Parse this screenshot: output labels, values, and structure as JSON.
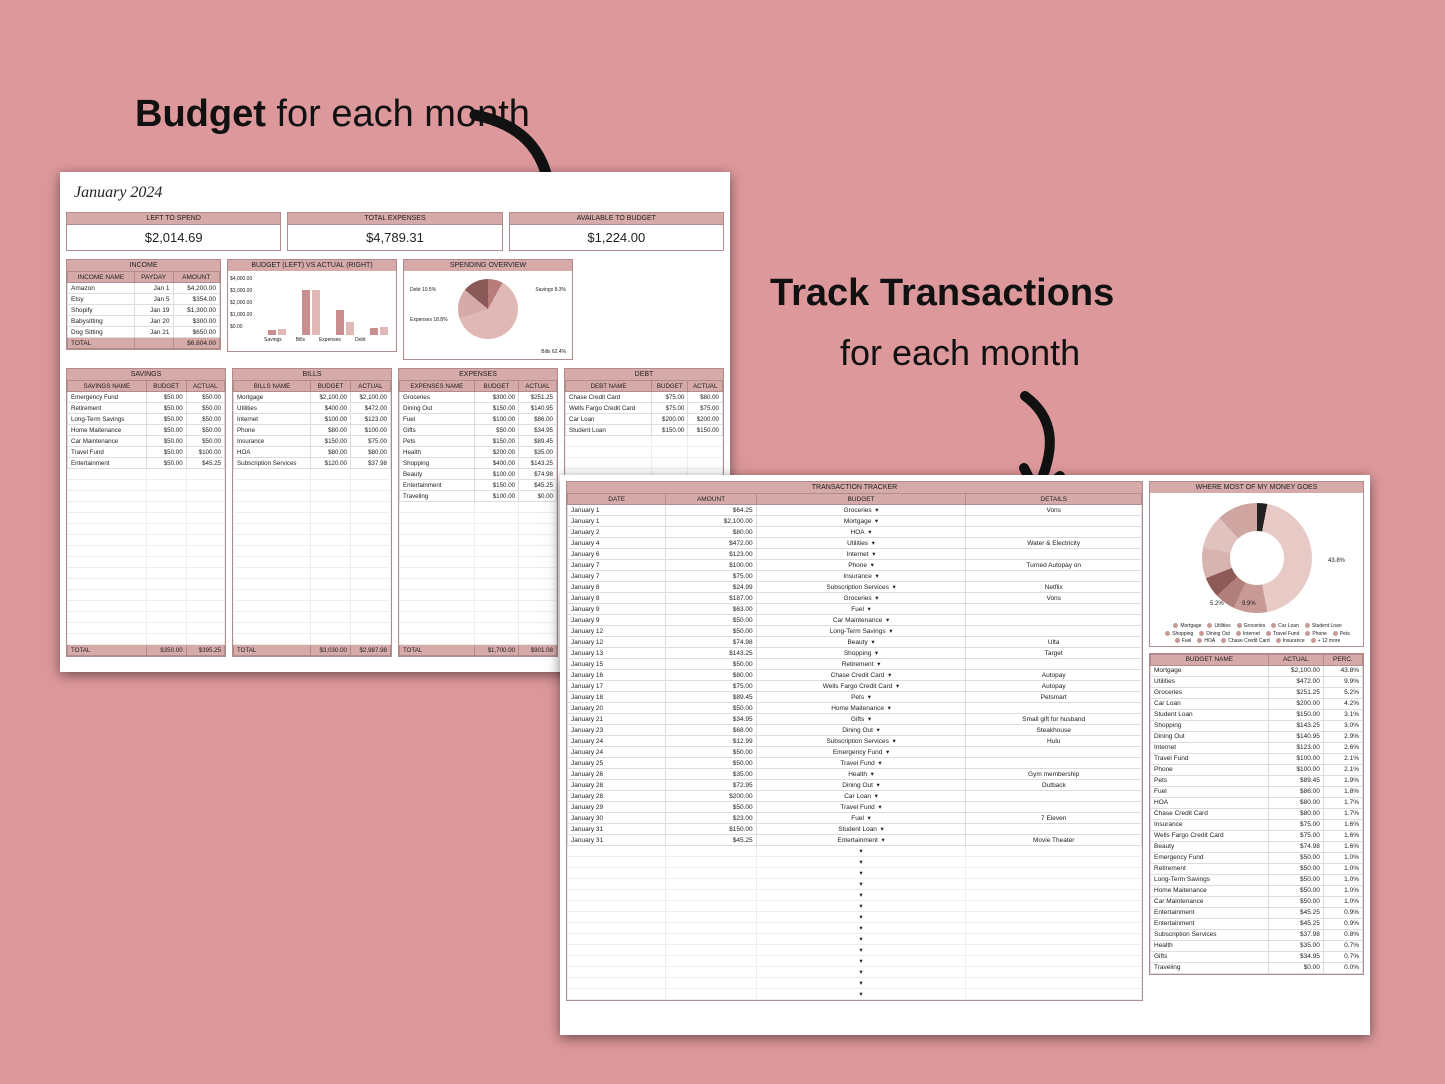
{
  "headings": {
    "h1_b": "Budget",
    "h1_r": " for each month",
    "h2_b": "Track Transactions",
    "h2_sub": "for each month"
  },
  "sheet1": {
    "title": "January 2024",
    "kpis": [
      {
        "label": "LEFT TO SPEND",
        "value": "$2,014.69"
      },
      {
        "label": "TOTAL EXPENSES",
        "value": "$4,789.31"
      },
      {
        "label": "AVAILABLE TO BUDGET",
        "value": "$1,224.00"
      }
    ],
    "income": {
      "title": "INCOME",
      "headers": [
        "INCOME NAME",
        "PAYDAY",
        "AMOUNT"
      ],
      "rows": [
        [
          "Amazon",
          "Jan 1",
          "$4,200.00"
        ],
        [
          "Etsy",
          "Jan 5",
          "$354.00"
        ],
        [
          "Shopify",
          "Jan 19",
          "$1,300.00"
        ],
        [
          "Babysitting",
          "Jan 20",
          "$300.00"
        ],
        [
          "Dog Sitting",
          "Jan 21",
          "$650.00"
        ]
      ],
      "total": [
        "TOTAL",
        "",
        "$6,804.00"
      ]
    },
    "chart": {
      "title": "BUDGET (LEFT) VS ACTUAL (RIGHT)",
      "ylabels": [
        "$4,000.00",
        "$3,000.00",
        "$2,000.00",
        "$1,000.00",
        "$0.00"
      ],
      "categories": [
        "Savings",
        "Bills",
        "Expenses",
        "Debt"
      ],
      "series": [
        {
          "name": "Budget",
          "values": [
            350,
            3030,
            1700,
            500
          ]
        },
        {
          "name": "Actual",
          "values": [
            395,
            2988,
            901,
            505
          ]
        }
      ]
    },
    "overview": {
      "title": "SPENDING OVERVIEW",
      "labels": {
        "debt": "Debt\n10.5%",
        "expenses": "Expenses\n18.8%",
        "savings": "Savings\n8.3%",
        "bills": "Bills\n62.4%"
      }
    },
    "savings": {
      "title": "SAVINGS",
      "headers": [
        "SAVINGS NAME",
        "BUDGET",
        "ACTUAL"
      ],
      "rows": [
        [
          "Emergency Fund",
          "$50.00",
          "$50.00"
        ],
        [
          "Retirement",
          "$50.00",
          "$50.00"
        ],
        [
          "Long-Term Savings",
          "$50.00",
          "$50.00"
        ],
        [
          "Home Maitenance",
          "$50.00",
          "$50.00"
        ],
        [
          "Car Maintenance",
          "$50.00",
          "$50.00"
        ],
        [
          "Travel Fund",
          "$50.00",
          "$100.00"
        ],
        [
          "Entertainment",
          "$50.00",
          "$45.25"
        ]
      ],
      "total": [
        "TOTAL",
        "$350.00",
        "$395.25"
      ]
    },
    "bills": {
      "title": "BILLS",
      "headers": [
        "BILLS NAME",
        "BUDGET",
        "ACTUAL"
      ],
      "rows": [
        [
          "Mortgage",
          "$2,100.00",
          "$2,100.00"
        ],
        [
          "Utilities",
          "$400.00",
          "$472.00"
        ],
        [
          "Internet",
          "$100.00",
          "$123.00"
        ],
        [
          "Phone",
          "$80.00",
          "$100.00"
        ],
        [
          "Insurance",
          "$150.00",
          "$75.00"
        ],
        [
          "HOA",
          "$80.00",
          "$80.00"
        ],
        [
          "Subscription Services",
          "$120.00",
          "$37.98"
        ]
      ],
      "total": [
        "TOTAL",
        "$3,030.00",
        "$2,987.98"
      ]
    },
    "expenses": {
      "title": "EXPENSES",
      "headers": [
        "EXPENSES NAME",
        "BUDGET",
        "ACTUAL"
      ],
      "rows": [
        [
          "Groceries",
          "$300.00",
          "$251.25"
        ],
        [
          "Dining Out",
          "$150.00",
          "$140.95"
        ],
        [
          "Fuel",
          "$100.00",
          "$86.00"
        ],
        [
          "Gifts",
          "$50.00",
          "$34.95"
        ],
        [
          "Pets",
          "$150.00",
          "$89.45"
        ],
        [
          "Health",
          "$200.00",
          "$35.00"
        ],
        [
          "Shopping",
          "$400.00",
          "$143.25"
        ],
        [
          "Beauty",
          "$100.00",
          "$74.98"
        ],
        [
          "Entertainment",
          "$150.00",
          "$45.25"
        ],
        [
          "Traveling",
          "$100.00",
          "$0.00"
        ]
      ],
      "total": [
        "TOTAL",
        "$1,700.00",
        "$901.08"
      ]
    },
    "debt": {
      "title": "DEBT",
      "headers": [
        "DEBT NAME",
        "BUDGET",
        "ACTUAL"
      ],
      "rows": [
        [
          "Chase Credit Card",
          "$75.00",
          "$80.00"
        ],
        [
          "Wells Fargo Credit Card",
          "$75.00",
          "$75.00"
        ],
        [
          "Car Loan",
          "$200.00",
          "$200.00"
        ],
        [
          "Student Loan",
          "$150.00",
          "$150.00"
        ]
      ]
    }
  },
  "sheet2": {
    "tracker": {
      "title": "TRANSACTION TRACKER",
      "headers": [
        "DATE",
        "AMOUNT",
        "BUDGET",
        "DETAILS"
      ],
      "rows": [
        [
          "January 1",
          "$64.25",
          "Groceries",
          "Vons"
        ],
        [
          "January 1",
          "$2,100.00",
          "Mortgage",
          ""
        ],
        [
          "January 2",
          "$80.00",
          "HOA",
          ""
        ],
        [
          "January 4",
          "$472.00",
          "Utilities",
          "Water & Electricity"
        ],
        [
          "January 6",
          "$123.00",
          "Internet",
          ""
        ],
        [
          "January 7",
          "$100.00",
          "Phone",
          "Turned Autopay on"
        ],
        [
          "January 7",
          "$75.00",
          "Insurance",
          ""
        ],
        [
          "January 8",
          "$24.99",
          "Subscription Services",
          "Netflix"
        ],
        [
          "January 8",
          "$187.00",
          "Groceries",
          "Vons"
        ],
        [
          "January 9",
          "$63.00",
          "Fuel",
          ""
        ],
        [
          "January 9",
          "$50.00",
          "Car Maintenance",
          ""
        ],
        [
          "January 12",
          "$50.00",
          "Long-Term Savings",
          ""
        ],
        [
          "January 12",
          "$74.98",
          "Beauty",
          "Ulta"
        ],
        [
          "January 13",
          "$143.25",
          "Shopping",
          "Target"
        ],
        [
          "January 15",
          "$50.00",
          "Retirement",
          ""
        ],
        [
          "January 16",
          "$80.00",
          "Chase Credit Card",
          "Autopay"
        ],
        [
          "January 17",
          "$75.00",
          "Wells Fargo Credit Card",
          "Autopay"
        ],
        [
          "January 18",
          "$89.45",
          "Pets",
          "Petsmart"
        ],
        [
          "January 20",
          "$50.00",
          "Home Maitenance",
          ""
        ],
        [
          "January 21",
          "$34.95",
          "Gifts",
          "Small gift for husband"
        ],
        [
          "January 23",
          "$68.00",
          "Dining Out",
          "Steakhouse"
        ],
        [
          "January 24",
          "$12.99",
          "Subscription Services",
          "Hulu"
        ],
        [
          "January 24",
          "$50.00",
          "Emergency Fund",
          ""
        ],
        [
          "January 25",
          "$50.00",
          "Travel Fund",
          ""
        ],
        [
          "January 26",
          "$35.00",
          "Health",
          "Gym membership"
        ],
        [
          "January 28",
          "$72.95",
          "Dining Out",
          "Outback"
        ],
        [
          "January 28",
          "$200.00",
          "Car Loan",
          ""
        ],
        [
          "January 29",
          "$50.00",
          "Travel Fund",
          ""
        ],
        [
          "January 30",
          "$23.00",
          "Fuel",
          "7 Eleven"
        ],
        [
          "January 31",
          "$150.00",
          "Student Loan",
          ""
        ],
        [
          "January 31",
          "$45.25",
          "Entertainment",
          "Movie Theater"
        ]
      ]
    },
    "side": {
      "title": "WHERE MOST OF MY MONEY GOES",
      "pct1": "43.8%",
      "pct2": "5.2%",
      "pct3": "9.9%",
      "legend": [
        "Mortgage",
        "Utilities",
        "Groceries",
        "Car Loan",
        "Student Loan",
        "Shopping",
        "Dining Out",
        "Internet",
        "Travel Fund",
        "Phone",
        "Pets",
        "Fuel",
        "HOA",
        "Chase Credit Card",
        "Insurance",
        "+ 12 more"
      ],
      "headers": [
        "BUDGET NAME",
        "ACTUAL",
        "PERC."
      ],
      "rows": [
        [
          "Mortgage",
          "$2,100.00",
          "43.8%"
        ],
        [
          "Utilities",
          "$472.00",
          "9.9%"
        ],
        [
          "Groceries",
          "$251.25",
          "5.2%"
        ],
        [
          "Car Loan",
          "$200.00",
          "4.2%"
        ],
        [
          "Student Loan",
          "$150.00",
          "3.1%"
        ],
        [
          "Shopping",
          "$143.25",
          "3.0%"
        ],
        [
          "Dining Out",
          "$140.95",
          "2.9%"
        ],
        [
          "Internet",
          "$123.00",
          "2.6%"
        ],
        [
          "Travel Fund",
          "$100.00",
          "2.1%"
        ],
        [
          "Phone",
          "$100.00",
          "2.1%"
        ],
        [
          "Pets",
          "$89.45",
          "1.9%"
        ],
        [
          "Fuel",
          "$86.00",
          "1.8%"
        ],
        [
          "HOA",
          "$80.00",
          "1.7%"
        ],
        [
          "Chase Credit Card",
          "$80.00",
          "1.7%"
        ],
        [
          "Insurance",
          "$75.00",
          "1.6%"
        ],
        [
          "Wells Fargo Credit Card",
          "$75.00",
          "1.6%"
        ],
        [
          "Beauty",
          "$74.98",
          "1.6%"
        ],
        [
          "Emergency Fund",
          "$50.00",
          "1.0%"
        ],
        [
          "Retirement",
          "$50.00",
          "1.0%"
        ],
        [
          "Long-Term Savings",
          "$50.00",
          "1.0%"
        ],
        [
          "Home Maitenance",
          "$50.00",
          "1.0%"
        ],
        [
          "Car Maintenance",
          "$50.00",
          "1.0%"
        ],
        [
          "Entertainment",
          "$45.25",
          "0.9%"
        ],
        [
          "Entertainment",
          "$45.25",
          "0.9%"
        ],
        [
          "Subscription Services",
          "$37.98",
          "0.8%"
        ],
        [
          "Health",
          "$35.00",
          "0.7%"
        ],
        [
          "Gifts",
          "$34.95",
          "0.7%"
        ],
        [
          "Traveling",
          "$0.00",
          "0.0%"
        ]
      ]
    }
  },
  "chart_data": [
    {
      "type": "bar",
      "title": "BUDGET (LEFT) VS ACTUAL (RIGHT)",
      "categories": [
        "Savings",
        "Bills",
        "Expenses",
        "Debt"
      ],
      "series": [
        {
          "name": "Budget",
          "values": [
            350,
            3030,
            1700,
            500
          ]
        },
        {
          "name": "Actual",
          "values": [
            395,
            2988,
            901,
            505
          ]
        }
      ],
      "ylabel": "$",
      "ylim": [
        0,
        4000
      ]
    },
    {
      "type": "pie",
      "title": "SPENDING OVERVIEW",
      "categories": [
        "Debt",
        "Expenses",
        "Bills",
        "Savings"
      ],
      "values": [
        10.5,
        18.8,
        62.4,
        8.3
      ]
    },
    {
      "type": "pie",
      "title": "WHERE MOST OF MY MONEY GOES",
      "categories": [
        "Mortgage",
        "Utilities",
        "Groceries",
        "Car Loan",
        "Student Loan",
        "Shopping",
        "Dining Out",
        "Internet",
        "Travel Fund",
        "Phone",
        "Pets",
        "Fuel",
        "HOA",
        "Chase Credit Card",
        "Insurance",
        "Wells Fargo Credit Card",
        "Beauty",
        "Emergency Fund",
        "Retirement",
        "Long-Term Savings",
        "Home Maitenance",
        "Car Maintenance",
        "Entertainment",
        "Entertainment",
        "Subscription Services",
        "Health",
        "Gifts",
        "Traveling"
      ],
      "values": [
        43.8,
        9.9,
        5.2,
        4.2,
        3.1,
        3.0,
        2.9,
        2.6,
        2.1,
        2.1,
        1.9,
        1.8,
        1.7,
        1.7,
        1.6,
        1.6,
        1.6,
        1.0,
        1.0,
        1.0,
        1.0,
        1.0,
        0.9,
        0.9,
        0.8,
        0.7,
        0.7,
        0.0
      ]
    }
  ]
}
